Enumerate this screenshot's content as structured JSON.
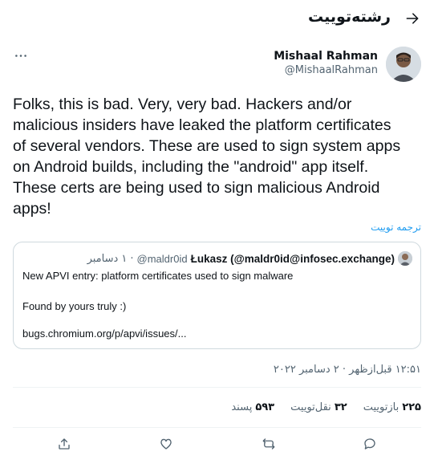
{
  "header": {
    "title": "رشته‌توییت",
    "back_icon": "arrow-right-icon"
  },
  "author": {
    "name": "Mishaal Rahman",
    "handle": "@MishaalRahman"
  },
  "tweet": {
    "lines": [
      "Folks, this is bad. Very, very bad. Hackers and/or",
      "malicious insiders have leaked the platform certificates",
      "of several vendors. These are used to sign system apps",
      "on Android builds, including the \"android\" app itself.",
      "These certs are being used to sign malicious Android",
      "apps!"
    ],
    "translate_label": "ترجمه توییت"
  },
  "quote": {
    "name": "Łukasz (@maldr0id@infosec.exchange)",
    "handle": "@maldr0id",
    "dot": "·",
    "date": "۱ دسامبر",
    "line1": "New APVI entry: platform certificates used to sign malware",
    "line2": "Found by yours truly :)",
    "line3": "bugs.chromium.org/p/apvi/issues/..."
  },
  "timestamp": "۱۲:۵۱ قبل‌ازظهر · ۲ دسامبر ۲۰۲۲",
  "stats": {
    "retweets_num": "۲۲۵",
    "retweets_label": "بازتوییت",
    "quotes_num": "۳۲",
    "quotes_label": "نقل‌توییت",
    "likes_num": "۵۹۳",
    "likes_label": "پسند"
  },
  "more_label": "···",
  "accent": "#1d9bf0"
}
